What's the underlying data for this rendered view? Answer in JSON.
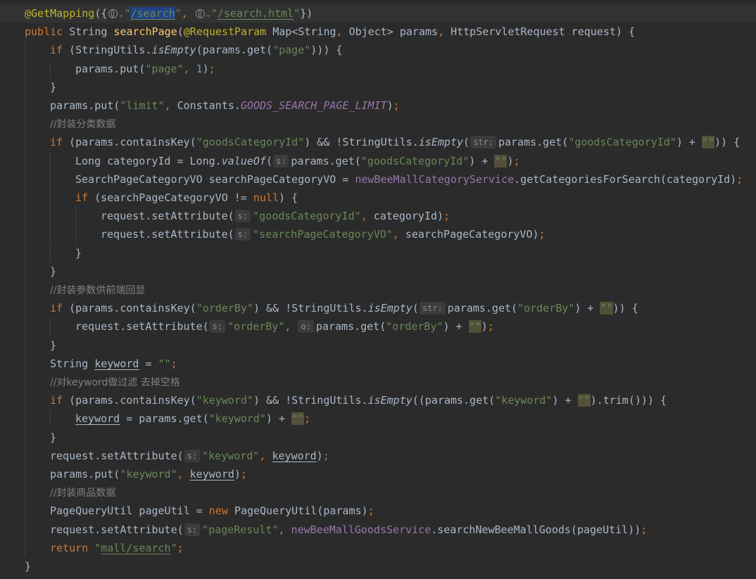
{
  "editor": {
    "language": "java",
    "colors": {
      "background": "#2b2b2b",
      "keyword": "#cc7832",
      "string": "#6a8759",
      "number": "#6897bb",
      "annotation": "#bbb529",
      "method": "#ffc66d",
      "field": "#9876aa",
      "comment": "#808080",
      "text": "#a9b7c6",
      "hint": "#8c8c8c"
    },
    "lines": [
      {
        "indent": 0,
        "tokens": [
          {
            "t": "@GetMapping",
            "c": "annotation"
          },
          {
            "t": "({",
            "c": "text"
          },
          {
            "icon": "globe-icon"
          },
          {
            "t": "\"",
            "c": "string"
          },
          {
            "t": "/search",
            "c": "string",
            "ul": true,
            "hl": true
          },
          {
            "t": "\"",
            "c": "string"
          },
          {
            "t": ", ",
            "c": "keyword"
          },
          {
            "icon": "globe-icon"
          },
          {
            "t": "\"",
            "c": "string"
          },
          {
            "t": "/search.html",
            "c": "string",
            "ul": true
          },
          {
            "t": "\"",
            "c": "string"
          },
          {
            "t": "})",
            "c": "text"
          }
        ]
      },
      {
        "indent": 0,
        "tokens": [
          {
            "t": "public ",
            "c": "keyword"
          },
          {
            "t": "String ",
            "c": "text"
          },
          {
            "t": "searchPage",
            "c": "method"
          },
          {
            "t": "(",
            "c": "text"
          },
          {
            "t": "@RequestParam ",
            "c": "annotation"
          },
          {
            "t": "Map<String",
            "c": "text"
          },
          {
            "t": ", ",
            "c": "keyword"
          },
          {
            "t": "Object> params",
            "c": "text"
          },
          {
            "t": ", ",
            "c": "keyword"
          },
          {
            "t": "HttpServletRequest request) {",
            "c": "text"
          }
        ]
      },
      {
        "indent": 1,
        "tokens": [
          {
            "t": "if ",
            "c": "keyword"
          },
          {
            "t": "(StringUtils.",
            "c": "text"
          },
          {
            "t": "isEmpty",
            "c": "text",
            "i": true
          },
          {
            "t": "(params.get(",
            "c": "text"
          },
          {
            "t": "\"page\"",
            "c": "string"
          },
          {
            "t": "))) {",
            "c": "text"
          }
        ]
      },
      {
        "indent": 2,
        "tokens": [
          {
            "t": "params.put(",
            "c": "text"
          },
          {
            "t": "\"page\"",
            "c": "string"
          },
          {
            "t": ", ",
            "c": "keyword"
          },
          {
            "t": "1",
            "c": "number"
          },
          {
            "t": ")",
            "c": "text"
          },
          {
            "t": ";",
            "c": "keyword"
          }
        ]
      },
      {
        "indent": 1,
        "tokens": [
          {
            "t": "}",
            "c": "text"
          }
        ]
      },
      {
        "indent": 1,
        "tokens": [
          {
            "t": "params.put(",
            "c": "text"
          },
          {
            "t": "\"limit\"",
            "c": "string"
          },
          {
            "t": ", ",
            "c": "keyword"
          },
          {
            "t": "Constants.",
            "c": "text"
          },
          {
            "t": "GOODS_SEARCH_PAGE_LIMIT",
            "c": "field",
            "i": true
          },
          {
            "t": ")",
            "c": "text"
          },
          {
            "t": ";",
            "c": "keyword"
          }
        ]
      },
      {
        "indent": 1,
        "tokens": [
          {
            "t": "//封装分类数据",
            "c": "comment",
            "cn": true
          }
        ]
      },
      {
        "indent": 1,
        "tokens": [
          {
            "t": "if ",
            "c": "keyword"
          },
          {
            "t": "(params.containsKey(",
            "c": "text"
          },
          {
            "t": "\"goodsCategoryId\"",
            "c": "string"
          },
          {
            "t": ") && !StringUtils.",
            "c": "text"
          },
          {
            "t": "isEmpty",
            "c": "text",
            "i": true
          },
          {
            "t": "(",
            "c": "text"
          },
          {
            "hint": "str:"
          },
          {
            "t": "params.get(",
            "c": "text"
          },
          {
            "t": "\"goodsCategoryId\"",
            "c": "string"
          },
          {
            "t": ") + ",
            "c": "text"
          },
          {
            "t": "\"\"",
            "c": "string",
            "bq": true
          },
          {
            "t": ")) {",
            "c": "text"
          }
        ]
      },
      {
        "indent": 2,
        "tokens": [
          {
            "t": "Long categoryId = Long.",
            "c": "text"
          },
          {
            "t": "valueOf",
            "c": "text",
            "i": true
          },
          {
            "t": "(",
            "c": "text"
          },
          {
            "hint": "s:"
          },
          {
            "t": "params.get(",
            "c": "text"
          },
          {
            "t": "\"goodsCategoryId\"",
            "c": "string"
          },
          {
            "t": ") + ",
            "c": "text"
          },
          {
            "t": "\"\"",
            "c": "string",
            "bq": true
          },
          {
            "t": ")",
            "c": "text"
          },
          {
            "t": ";",
            "c": "keyword"
          }
        ]
      },
      {
        "indent": 2,
        "tokens": [
          {
            "t": "SearchPageCategoryVO searchPageCategoryVO = ",
            "c": "text"
          },
          {
            "t": "newBeeMallCategoryService",
            "c": "field"
          },
          {
            "t": ".getCategoriesForSearch(categoryId)",
            "c": "text"
          },
          {
            "t": ";",
            "c": "keyword"
          }
        ]
      },
      {
        "indent": 2,
        "tokens": [
          {
            "t": "if ",
            "c": "keyword"
          },
          {
            "t": "(searchPageCategoryVO != ",
            "c": "text"
          },
          {
            "t": "null",
            "c": "keyword"
          },
          {
            "t": ") {",
            "c": "text"
          }
        ]
      },
      {
        "indent": 3,
        "tokens": [
          {
            "t": "request.setAttribute(",
            "c": "text"
          },
          {
            "hint": "s:"
          },
          {
            "t": "\"goodsCategoryId\"",
            "c": "string"
          },
          {
            "t": ", ",
            "c": "keyword"
          },
          {
            "t": "categoryId)",
            "c": "text"
          },
          {
            "t": ";",
            "c": "keyword"
          }
        ]
      },
      {
        "indent": 3,
        "tokens": [
          {
            "t": "request.setAttribute(",
            "c": "text"
          },
          {
            "hint": "s:"
          },
          {
            "t": "\"searchPageCategoryVO\"",
            "c": "string"
          },
          {
            "t": ", ",
            "c": "keyword"
          },
          {
            "t": "searchPageCategoryVO)",
            "c": "text"
          },
          {
            "t": ";",
            "c": "keyword"
          }
        ]
      },
      {
        "indent": 2,
        "tokens": [
          {
            "t": "}",
            "c": "text"
          }
        ]
      },
      {
        "indent": 1,
        "tokens": [
          {
            "t": "}",
            "c": "text"
          }
        ]
      },
      {
        "indent": 1,
        "tokens": [
          {
            "t": "//封装参数供前端回显",
            "c": "comment",
            "cn": true
          }
        ]
      },
      {
        "indent": 1,
        "tokens": [
          {
            "t": "if ",
            "c": "keyword"
          },
          {
            "t": "(params.containsKey(",
            "c": "text"
          },
          {
            "t": "\"orderBy\"",
            "c": "string"
          },
          {
            "t": ") && !StringUtils.",
            "c": "text"
          },
          {
            "t": "isEmpty",
            "c": "text",
            "i": true
          },
          {
            "t": "(",
            "c": "text"
          },
          {
            "hint": "str:"
          },
          {
            "t": "params.get(",
            "c": "text"
          },
          {
            "t": "\"orderBy\"",
            "c": "string"
          },
          {
            "t": ") + ",
            "c": "text"
          },
          {
            "t": "\"\"",
            "c": "string",
            "bq": true
          },
          {
            "t": ")) {",
            "c": "text"
          }
        ]
      },
      {
        "indent": 2,
        "tokens": [
          {
            "t": "request.setAttribute(",
            "c": "text"
          },
          {
            "hint": "s:"
          },
          {
            "t": "\"orderBy\"",
            "c": "string"
          },
          {
            "t": ", ",
            "c": "keyword"
          },
          {
            "hint": "o:"
          },
          {
            "t": "params.get(",
            "c": "text"
          },
          {
            "t": "\"orderBy\"",
            "c": "string"
          },
          {
            "t": ") + ",
            "c": "text"
          },
          {
            "t": "\"\"",
            "c": "string",
            "bq": true
          },
          {
            "t": ")",
            "c": "text"
          },
          {
            "t": ";",
            "c": "keyword"
          }
        ]
      },
      {
        "indent": 1,
        "tokens": [
          {
            "t": "}",
            "c": "text"
          }
        ]
      },
      {
        "indent": 1,
        "tokens": [
          {
            "t": "String ",
            "c": "text"
          },
          {
            "t": "keyword",
            "c": "text",
            "ul": true
          },
          {
            "t": " = ",
            "c": "text"
          },
          {
            "t": "\"\"",
            "c": "string"
          },
          {
            "t": ";",
            "c": "keyword"
          }
        ]
      },
      {
        "indent": 1,
        "tokens": [
          {
            "t": "//对keyword做过滤 去掉空格",
            "c": "comment",
            "cn": true
          }
        ]
      },
      {
        "indent": 1,
        "tokens": [
          {
            "t": "if ",
            "c": "keyword"
          },
          {
            "t": "(params.containsKey(",
            "c": "text"
          },
          {
            "t": "\"keyword\"",
            "c": "string"
          },
          {
            "t": ") && !StringUtils.",
            "c": "text"
          },
          {
            "t": "isEmpty",
            "c": "text",
            "i": true
          },
          {
            "t": "((params.get(",
            "c": "text"
          },
          {
            "t": "\"keyword\"",
            "c": "string"
          },
          {
            "t": ") + ",
            "c": "text"
          },
          {
            "t": "\"\"",
            "c": "string",
            "bq": true
          },
          {
            "t": ").trim())) {",
            "c": "text"
          }
        ]
      },
      {
        "indent": 2,
        "tokens": [
          {
            "t": "keyword",
            "c": "text",
            "ul": true
          },
          {
            "t": " = params.get(",
            "c": "text"
          },
          {
            "t": "\"keyword\"",
            "c": "string"
          },
          {
            "t": ") + ",
            "c": "text"
          },
          {
            "t": "\"\"",
            "c": "string",
            "bq": true
          },
          {
            "t": ";",
            "c": "keyword"
          }
        ]
      },
      {
        "indent": 1,
        "tokens": [
          {
            "t": "}",
            "c": "text"
          }
        ]
      },
      {
        "indent": 1,
        "tokens": [
          {
            "t": "request.setAttribute(",
            "c": "text"
          },
          {
            "hint": "s:"
          },
          {
            "t": "\"keyword\"",
            "c": "string"
          },
          {
            "t": ", ",
            "c": "keyword"
          },
          {
            "t": "keyword",
            "c": "text",
            "ul": true
          },
          {
            "t": ")",
            "c": "text"
          },
          {
            "t": ";",
            "c": "keyword"
          }
        ]
      },
      {
        "indent": 1,
        "tokens": [
          {
            "t": "params.put(",
            "c": "text"
          },
          {
            "t": "\"keyword\"",
            "c": "string"
          },
          {
            "t": ", ",
            "c": "keyword"
          },
          {
            "t": "keyword",
            "c": "text",
            "ul": true
          },
          {
            "t": ")",
            "c": "text"
          },
          {
            "t": ";",
            "c": "keyword"
          }
        ]
      },
      {
        "indent": 1,
        "tokens": [
          {
            "t": "//封装商品数据",
            "c": "comment",
            "cn": true
          }
        ]
      },
      {
        "indent": 1,
        "tokens": [
          {
            "t": "PageQueryUtil pageUtil = ",
            "c": "text"
          },
          {
            "t": "new ",
            "c": "keyword"
          },
          {
            "t": "PageQueryUtil(params)",
            "c": "text"
          },
          {
            "t": ";",
            "c": "keyword"
          }
        ]
      },
      {
        "indent": 1,
        "tokens": [
          {
            "t": "request.setAttribute(",
            "c": "text"
          },
          {
            "hint": "s:"
          },
          {
            "t": "\"pageResult\"",
            "c": "string"
          },
          {
            "t": ", ",
            "c": "keyword"
          },
          {
            "t": "newBeeMallGoodsService",
            "c": "field"
          },
          {
            "t": ".searchNewBeeMallGoods(pageUtil))",
            "c": "text"
          },
          {
            "t": ";",
            "c": "keyword"
          }
        ]
      },
      {
        "indent": 1,
        "tokens": [
          {
            "t": "return ",
            "c": "keyword"
          },
          {
            "t": "\"",
            "c": "string"
          },
          {
            "t": "mall/search",
            "c": "string",
            "ul": true
          },
          {
            "t": "\"",
            "c": "string"
          },
          {
            "t": ";",
            "c": "keyword"
          }
        ]
      },
      {
        "indent": 0,
        "tokens": [
          {
            "t": "}",
            "c": "text"
          }
        ]
      }
    ]
  }
}
